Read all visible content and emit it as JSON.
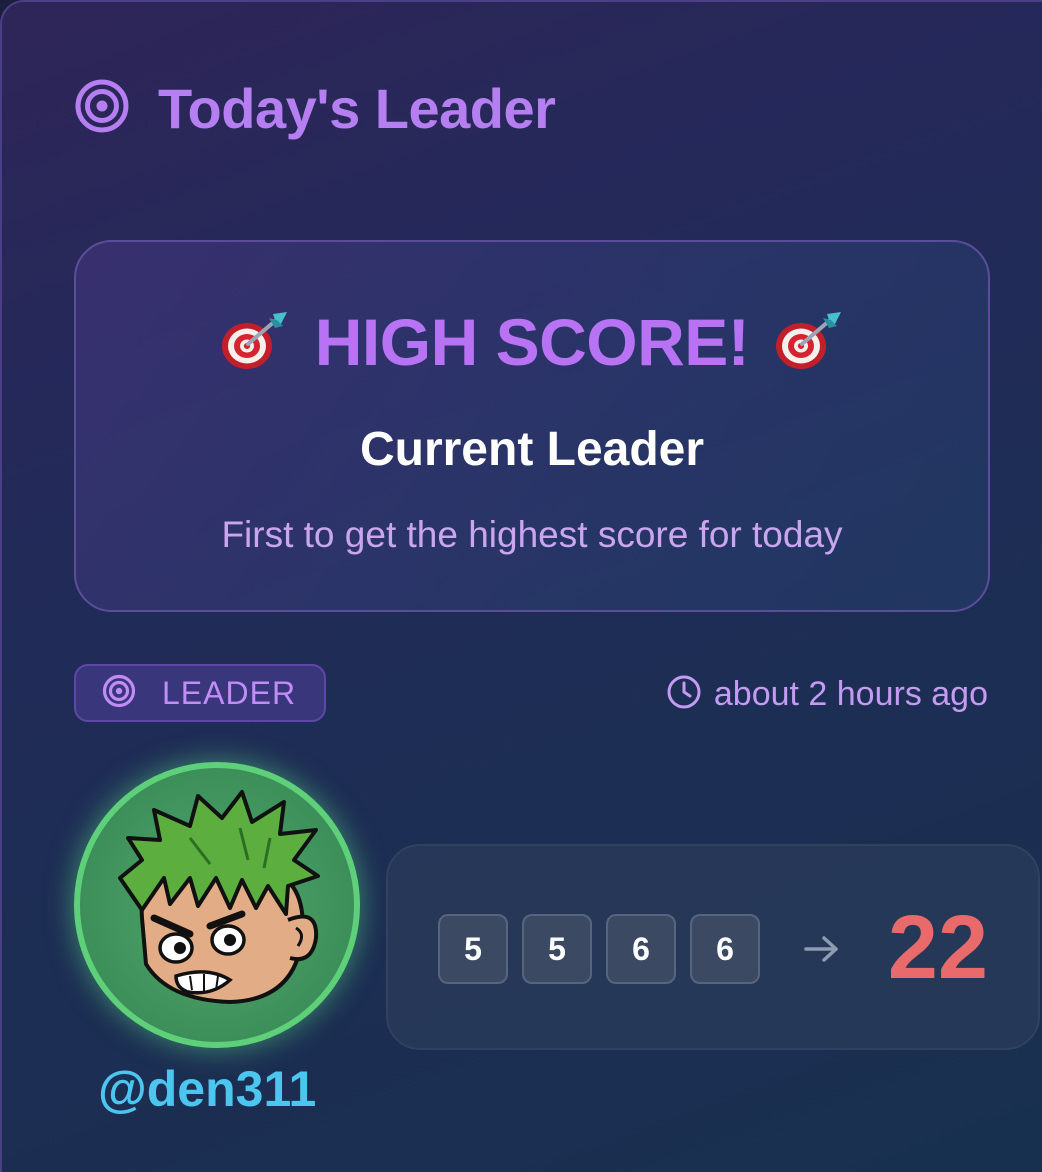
{
  "header": {
    "title": "Today's Leader",
    "icon": "target-icon"
  },
  "hero": {
    "title": "HIGH SCORE!",
    "icon": "dart-target-icon",
    "subtitle": "Current Leader",
    "description": "First to get the highest score for today"
  },
  "badge": {
    "label": "LEADER",
    "icon": "target-icon"
  },
  "time": {
    "label": "about 2 hours ago",
    "icon": "clock-icon"
  },
  "user": {
    "handle": "@den311",
    "avatar": "cartoon-avatar"
  },
  "roll": {
    "dice": [
      "5",
      "5",
      "6",
      "6"
    ],
    "arrow": "arrow-right-icon",
    "total": "22"
  },
  "colors": {
    "accent_purple": "#b57ff2",
    "username_cyan": "#4cc6ee",
    "total_red": "#e86a6a",
    "avatar_ring_green": "#5fd07a"
  }
}
